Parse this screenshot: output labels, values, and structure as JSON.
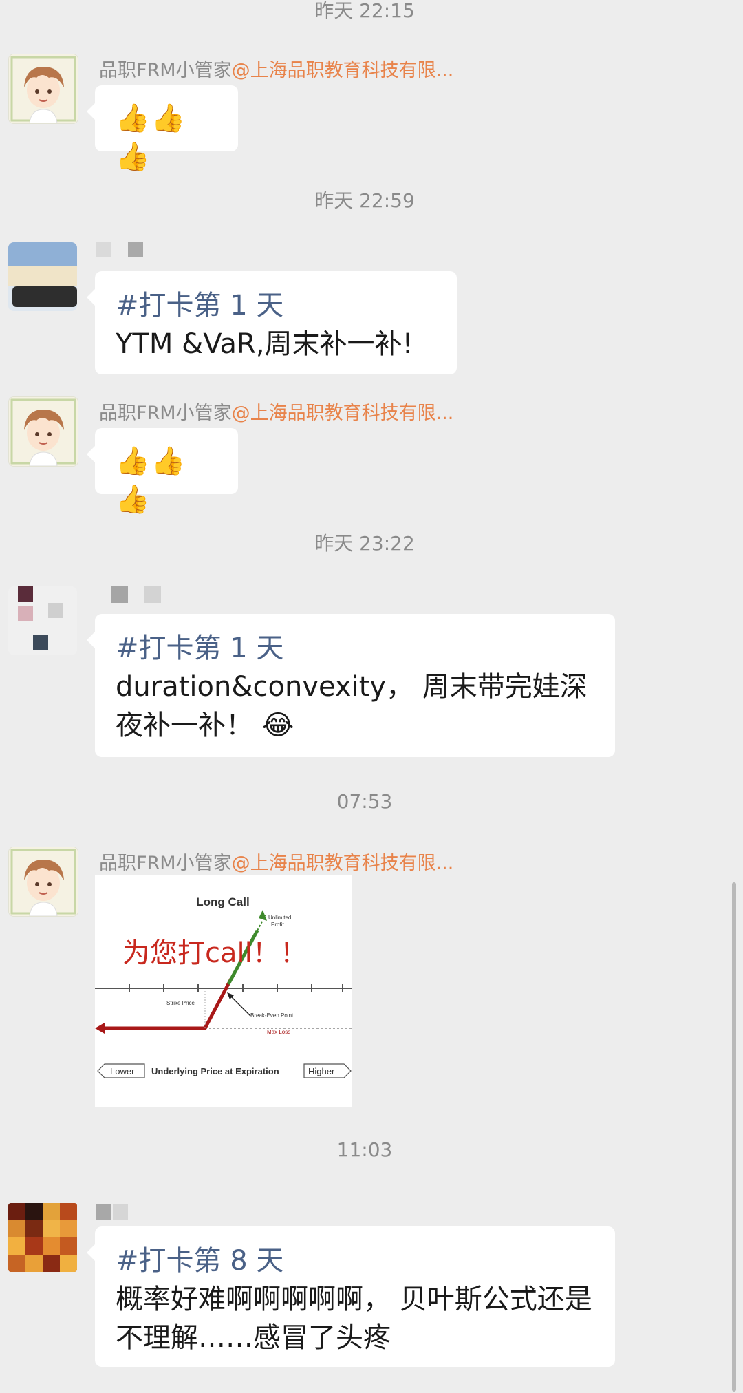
{
  "timestamps": [
    "昨天 22:15",
    "昨天 22:59",
    "昨天 23:22",
    "07:53",
    "11:03"
  ],
  "bot": {
    "name": "品职FRM小管家",
    "mention": "@上海品职教育科技有限...",
    "thumbs": "👍👍👍"
  },
  "messages": {
    "m2": {
      "tag": "#打卡第 1 天",
      "text": "YTM &VaR,周末补一补!"
    },
    "m4": {
      "tag": "#打卡第 1 天",
      "text": "duration&convexity， 周末带完娃深夜补一补！ 😂"
    },
    "m6": {
      "tag": "#打卡第 8 天",
      "text": "概率好难啊啊啊啊啊， 贝叶斯公式还是不理解……感冒了头疼"
    }
  },
  "image_msg": {
    "title": "Long Call",
    "overlay": "为您打call！！",
    "unlimited_profit": [
      "Unlimited",
      "Profit"
    ],
    "strike_price": "Strike Price",
    "break_even": "Break-Even Point",
    "max_loss": "Max Loss",
    "lower": "Lower",
    "axis_label": "Underlying Price at Expiration",
    "higher": "Higher"
  },
  "colors": {
    "background": "#ededed",
    "bubble": "#ffffff",
    "tag": "#4a6187",
    "mention": "#e8834a",
    "timestamp": "#8a8a8a"
  }
}
